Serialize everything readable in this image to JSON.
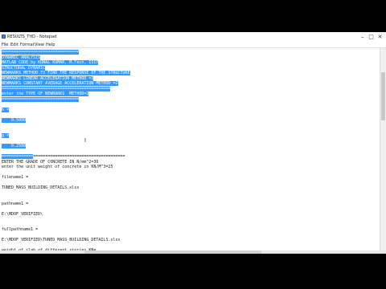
{
  "window": {
    "title": "RESULTS_THD - Notepad"
  },
  "window_controls": {
    "minimize": "–",
    "maximize": "□",
    "close": "✕"
  },
  "menu": [
    "File",
    "Edit",
    "Format",
    "View",
    "Help"
  ],
  "lines": [
    {
      "text": "================================",
      "selected": true
    },
    {
      "text": "DYNAMIC ANALYSIS",
      "selected": true
    },
    {
      "text": "MATLAB CODE by KUNAL KUMAR, M.Tech, IIIT",
      "selected": true
    },
    {
      "text": "STRUCTURAL DYNAMIC",
      "selected": true
    },
    {
      "text": "NEWMARKS METHOD TO FIND THE RESPONSE OF THE STRUCTURE",
      "selected": true
    },
    {
      "text": "NEWMARKS LINEAR ACCELERATION METHOD =1",
      "selected": true
    },
    {
      "text": "NEWMARKS CONSTANT AVERAGE ACCELERATION METHOD =2",
      "selected": true
    },
    {
      "text": "=============================================",
      "selected": true
    },
    {
      "text": "enter the TYPE OF NEWMARKS  METHOD=2",
      "selected": true
    },
    {
      "text": "================================",
      "selected": true
    },
    {
      "text": "",
      "selected": false
    },
    {
      "text": "b =",
      "selected": true
    },
    {
      "text": "",
      "selected": false
    },
    {
      "text": "    0.5000",
      "selected": true
    },
    {
      "text": "",
      "selected": false
    },
    {
      "text": "",
      "selected": false
    },
    {
      "text": "g =",
      "selected": true
    },
    {
      "text": "",
      "selected": false
    },
    {
      "text": "    0.2500",
      "selected": true
    },
    {
      "text": "",
      "selected": false
    },
    {
      "text": "===================================================",
      "selected": false,
      "partial": "============="
    },
    {
      "text": "ENTER THE GRADE OF CONCRETE IN N/mm^2=30",
      "selected": false
    },
    {
      "text": "enter the unit weight of concrete in KN/M^3=25",
      "selected": false
    },
    {
      "text": "",
      "selected": false
    },
    {
      "text": "filename1 =",
      "selected": false
    },
    {
      "text": "",
      "selected": false
    },
    {
      "text": "TUNED_MASS_BUILDING_DETAILS.xlsx",
      "selected": false
    },
    {
      "text": "",
      "selected": false
    },
    {
      "text": "",
      "selected": false
    },
    {
      "text": "pathname1 =",
      "selected": false
    },
    {
      "text": "",
      "selected": false
    },
    {
      "text": "E:\\MDOF_VERIFIED\\",
      "selected": false
    },
    {
      "text": "",
      "selected": false
    },
    {
      "text": "",
      "selected": false
    },
    {
      "text": "fullpathname1 =",
      "selected": false
    },
    {
      "text": "",
      "selected": false
    },
    {
      "text": "E:\\MDOF_VERIFIED\\TUNED_MASS_BUILDING_DETAILS.xlsx",
      "selected": false
    },
    {
      "text": "",
      "selected": false
    },
    {
      "text": "weight of slab of different stories KN=",
      "selected": false
    }
  ]
}
